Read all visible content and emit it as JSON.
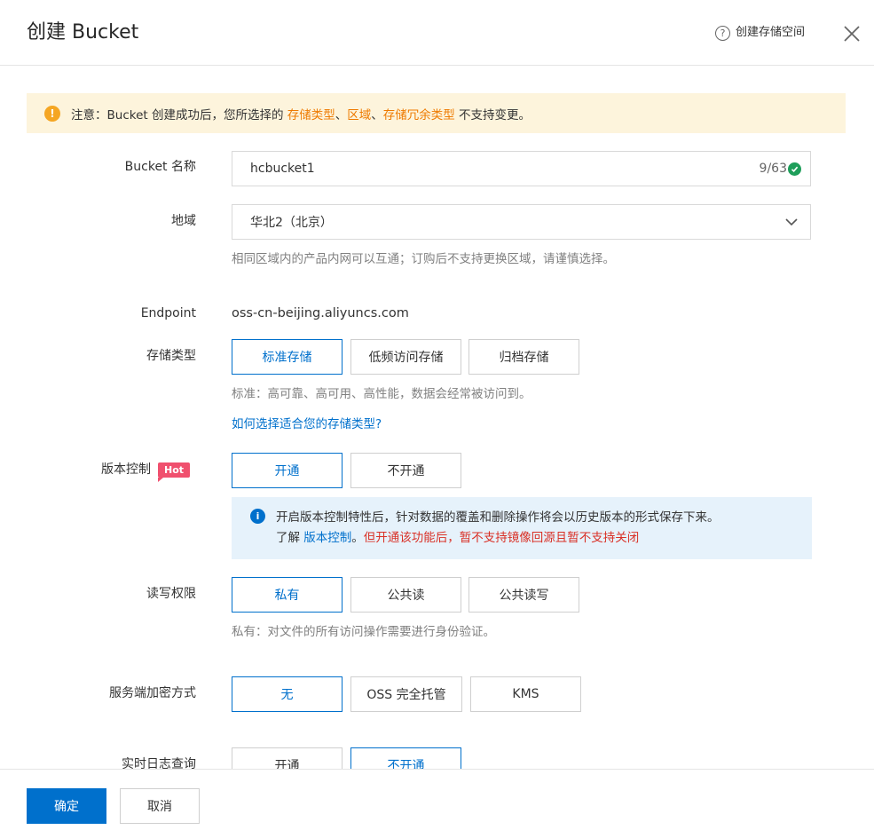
{
  "header": {
    "title": "创建 Bucket",
    "help_label": "创建存储空间"
  },
  "notice": {
    "prefix": "注意：Bucket 创建成功后，您所选择的 ",
    "hl1": "存储类型",
    "sep1": "、",
    "hl2": "区域",
    "sep2": "、",
    "hl3": "存储冗余类型",
    "suffix": " 不支持变更。"
  },
  "bucket_name": {
    "label": "Bucket 名称",
    "value": "hcbucket1",
    "count": "9/63"
  },
  "region": {
    "label": "地域",
    "value": "华北2（北京）",
    "hint": "相同区域内的产品内网可以互通；订购后不支持更换区域，请谨慎选择。"
  },
  "endpoint": {
    "label": "Endpoint",
    "value": "oss-cn-beijing.aliyuncs.com"
  },
  "storage_class": {
    "label": "存储类型",
    "options": [
      "标准存储",
      "低频访问存储",
      "归档存储"
    ],
    "selected": "标准存储",
    "hint": "标准：高可靠、高可用、高性能，数据会经常被访问到。",
    "link": "如何选择适合您的存储类型?"
  },
  "versioning": {
    "label": "版本控制",
    "badge": "Hot",
    "options": [
      "开通",
      "不开通"
    ],
    "selected": "开通",
    "info_line1": "开启版本控制特性后，针对数据的覆盖和删除操作将会以历史版本的形式保存下来。",
    "info_prefix": "了解 ",
    "info_link": "版本控制",
    "info_dot": "。",
    "info_warning": "但开通该功能后，暂不支持镜像回源且暂不支持关闭"
  },
  "acl": {
    "label": "读写权限",
    "options": [
      "私有",
      "公共读",
      "公共读写"
    ],
    "selected": "私有",
    "hint": "私有：对文件的所有访问操作需要进行身份验证。"
  },
  "encryption": {
    "label": "服务端加密方式",
    "options": [
      "无",
      "OSS 完全托管",
      "KMS"
    ],
    "selected": "无"
  },
  "realtime_log": {
    "label": "实时日志查询",
    "options": [
      "开通",
      "不开通"
    ],
    "selected": "不开通"
  },
  "footer": {
    "confirm": "确定",
    "cancel": "取消"
  },
  "colors": {
    "primary": "#0070cc",
    "notice_bg": "#fdf4dc",
    "notice_highlight": "#ee7a00",
    "info_bg": "#e6f2fb",
    "warning_text": "#d93026",
    "hot_badge": "#f0506e",
    "success": "#1e9e5a"
  },
  "icons": [
    "question-circle-icon",
    "close-icon",
    "warning-icon",
    "check-circle-icon",
    "chevron-down-icon",
    "info-icon"
  ]
}
